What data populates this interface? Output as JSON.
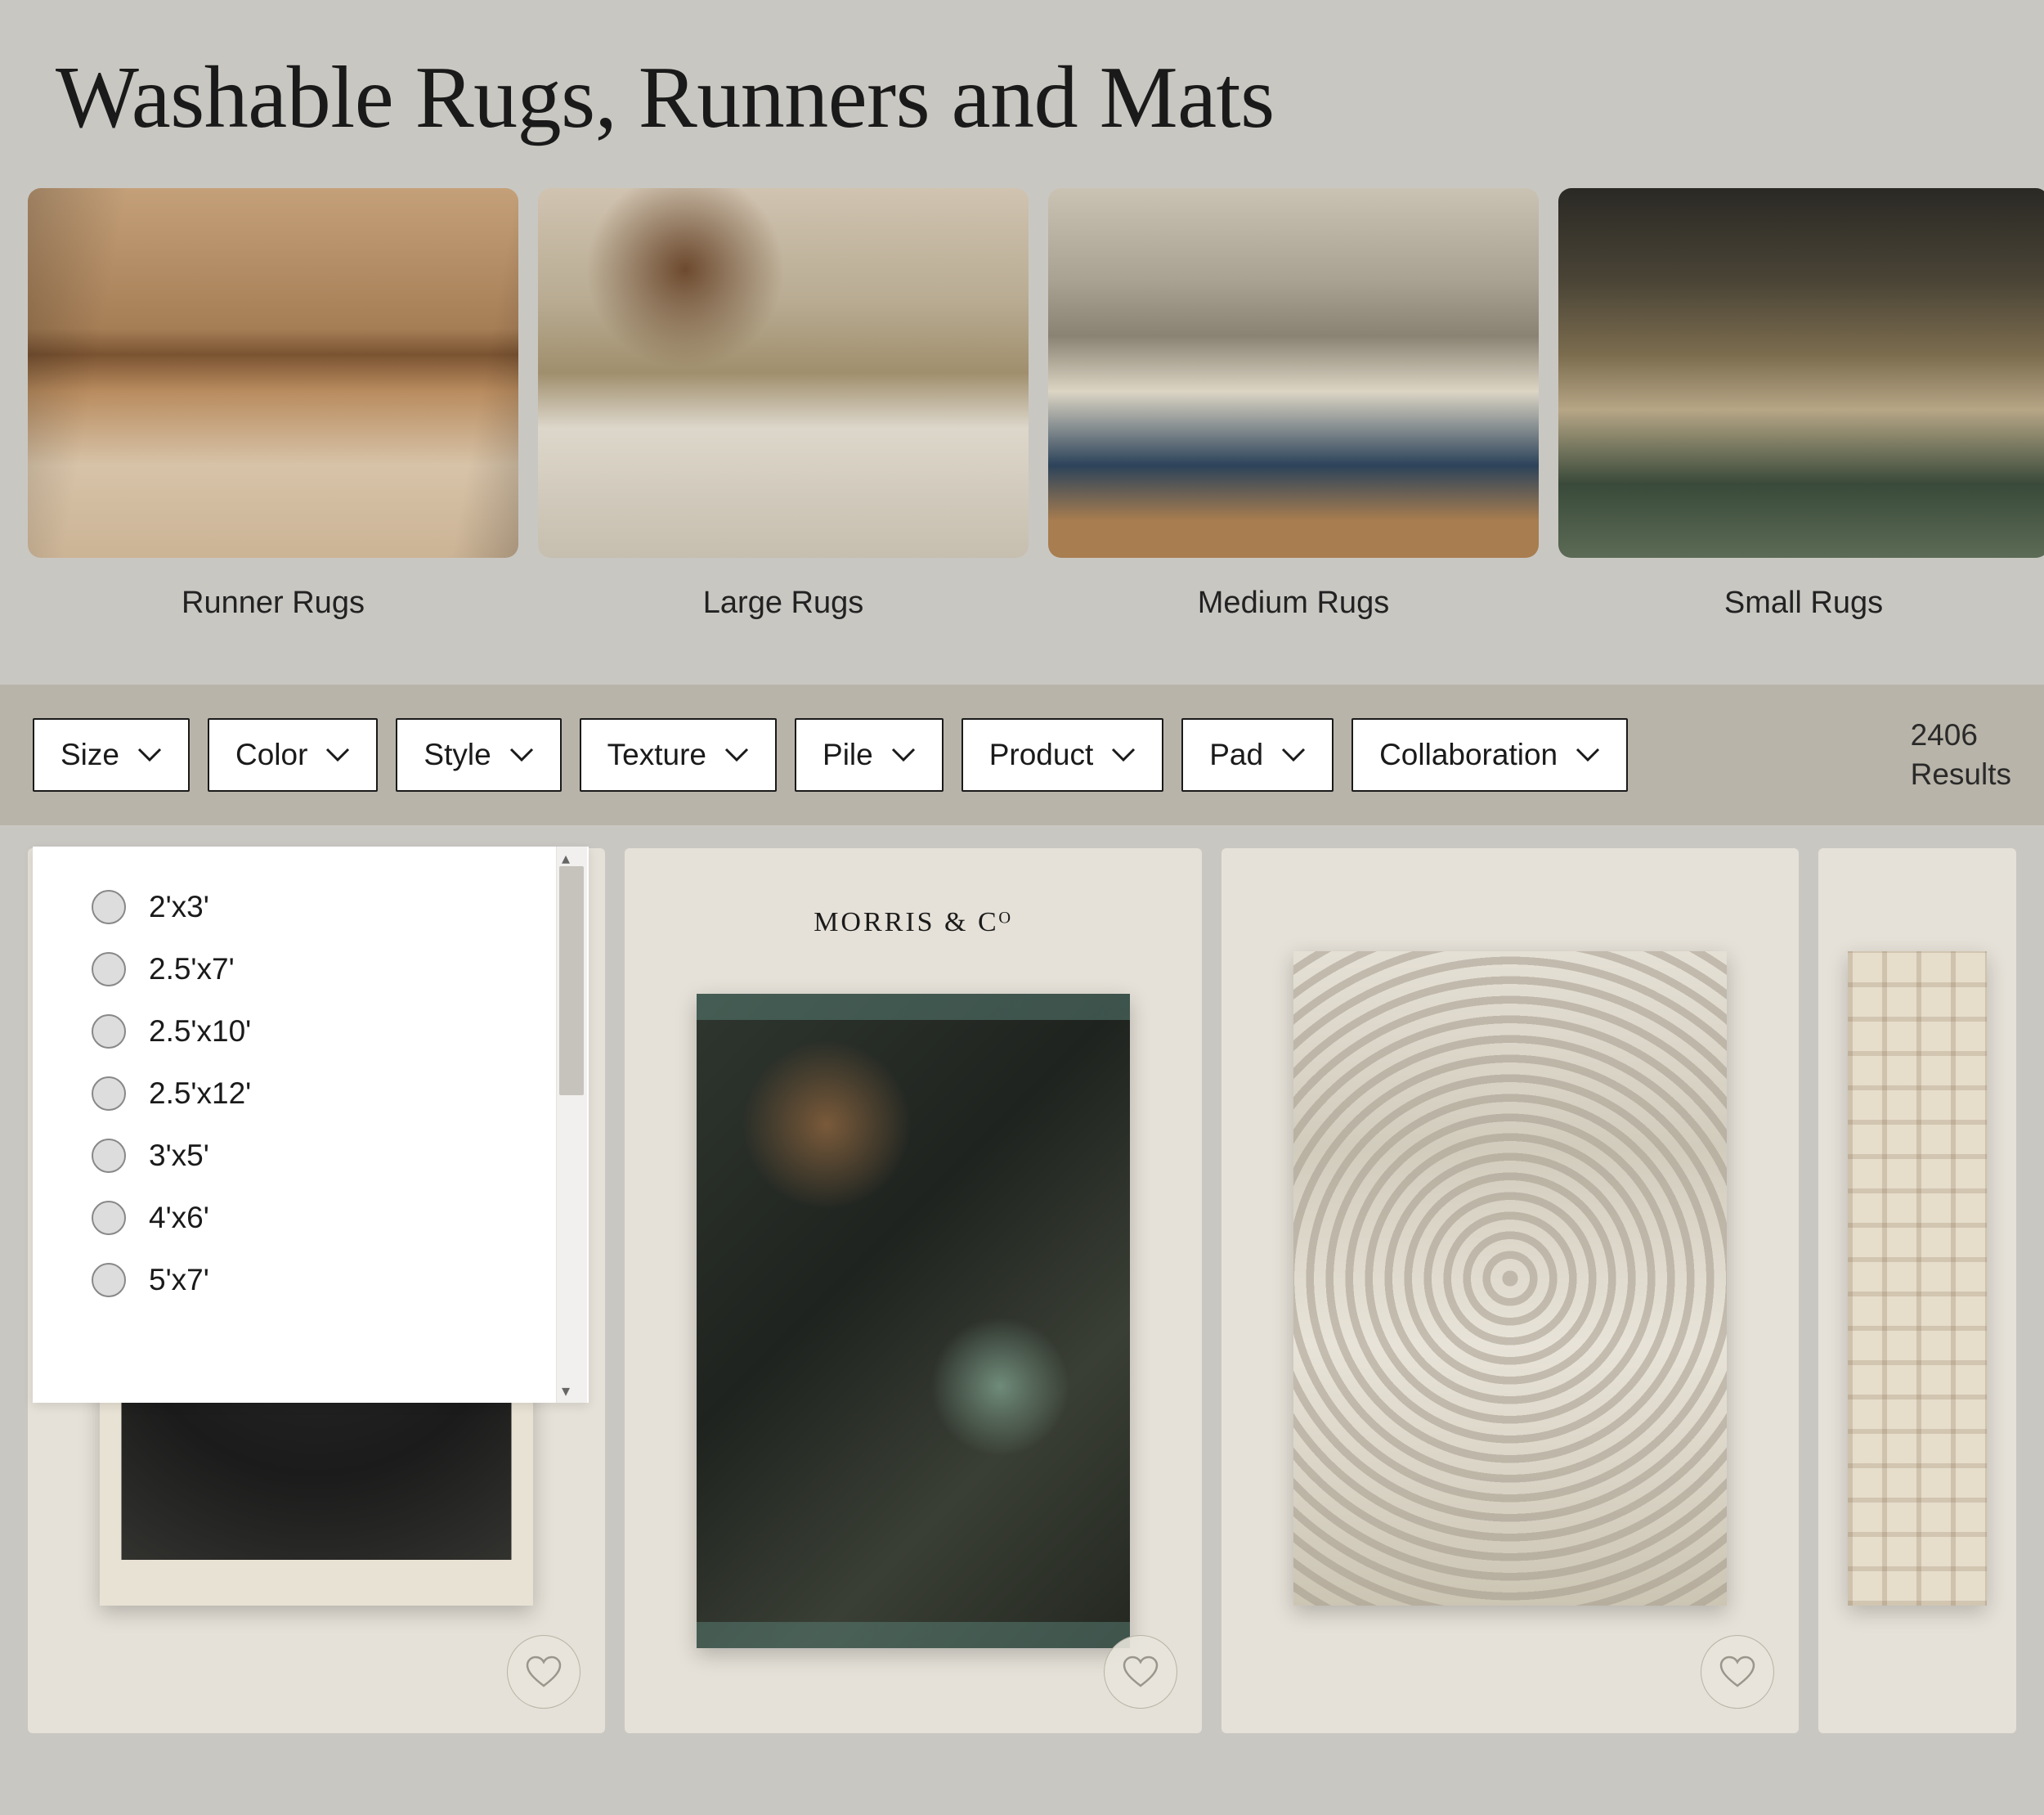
{
  "page_title": "Washable Rugs, Runners and Mats",
  "categories": [
    {
      "label": "Runner Rugs"
    },
    {
      "label": "Large Rugs"
    },
    {
      "label": "Medium Rugs"
    },
    {
      "label": "Small Rugs"
    }
  ],
  "filters": {
    "size": "Size",
    "color": "Color",
    "style": "Style",
    "texture": "Texture",
    "pile": "Pile",
    "product": "Product",
    "pad": "Pad",
    "collaboration": "Collaboration"
  },
  "results": {
    "count": "2406",
    "label": "Results"
  },
  "size_options": [
    "2'x3'",
    "2.5'x7'",
    "2.5'x10'",
    "2.5'x12'",
    "3'x5'",
    "4'x6'",
    "5'x7'"
  ],
  "brand_morris": "MORRIS & Cᴼ",
  "colors": {
    "heart_stroke": "#9a968c"
  }
}
